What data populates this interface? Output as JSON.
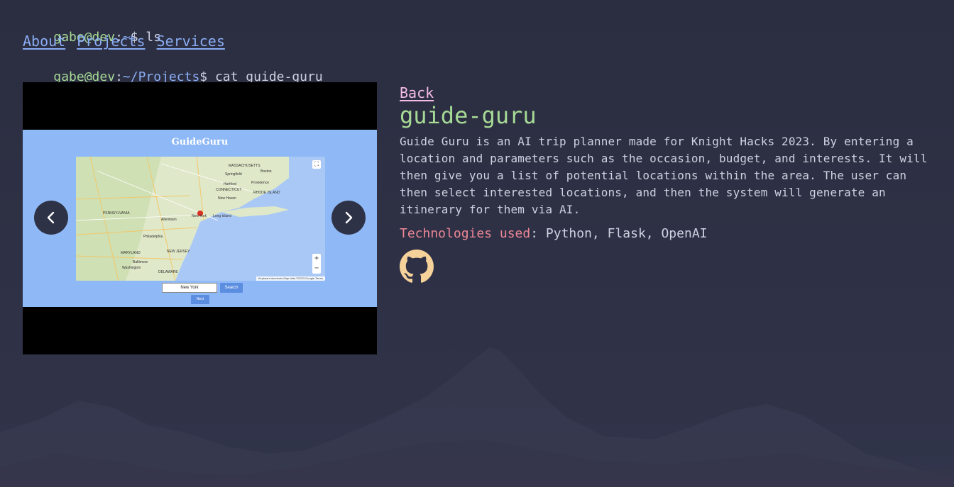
{
  "colors": {
    "background": "#2b2d40",
    "prompt_user": "#a6da95",
    "prompt_path": "#8aadf4",
    "link": "#8aadf4",
    "back_link": "#f5bde6",
    "title": "#a6da95",
    "tech_label": "#ed8796",
    "github_icon": "#f5d29a"
  },
  "terminal": {
    "line1": {
      "user": "gabe@dev",
      "colon": ":",
      "path": "~",
      "dollar": "$",
      "command": " ls"
    },
    "nav": [
      "About",
      "Projects",
      "Services"
    ],
    "line2": {
      "user": "gabe@dev",
      "colon": ":",
      "path": "~/Projects",
      "dollar": "$",
      "command": " cat guide-guru"
    }
  },
  "carousel": {
    "prev_icon": "chevron-left-icon",
    "next_icon": "chevron-right-icon",
    "slide": {
      "app_title": "GuideGuru",
      "map_labels": [
        "MASSACHUSETTS",
        "Boston",
        "CONNECTICUT",
        "RHODE ISLAND",
        "Providence",
        "Springfield",
        "Hartford",
        "New Haven",
        "PENNSYLVANIA",
        "New York",
        "Long Island",
        "Allentown",
        "NEW JERSEY",
        "Philadelphia",
        "MARYLAND",
        "Baltimore",
        "Washington",
        "DELAWARE"
      ],
      "map_attribution": "Keyboard shortcuts  Map data ©2023 Google  Terms",
      "search_value": "New York",
      "search_button": "Search",
      "next_button": "Next"
    }
  },
  "project": {
    "back_label": "Back",
    "title": "guide-guru",
    "description": "Guide Guru is an AI trip planner made for Knight Hacks 2023. By entering a location and parameters such as the occasion, budget, and interests. It will then give you a list of potential locations within the area. The user can then select interested locations, and then the system will generate an itinerary for them via AI.",
    "tech_label": "Technologies used",
    "tech_colon": ":",
    "tech_list": " Python, Flask, OpenAI",
    "github_icon": "github-icon"
  }
}
